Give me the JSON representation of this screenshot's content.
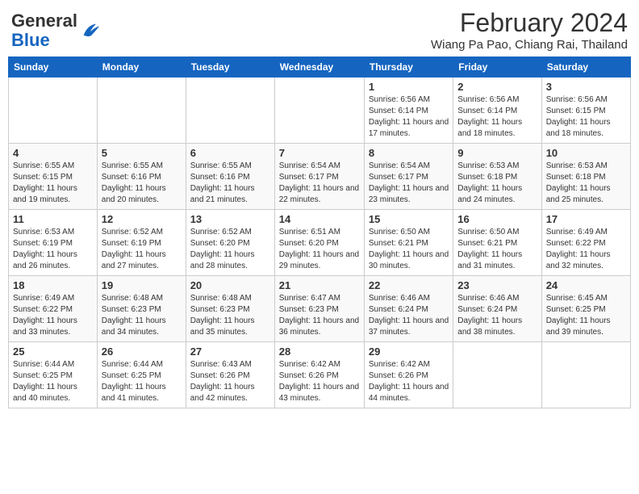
{
  "header": {
    "logo_general": "General",
    "logo_blue": "Blue",
    "month_year": "February 2024",
    "location": "Wiang Pa Pao, Chiang Rai, Thailand"
  },
  "days_of_week": [
    "Sunday",
    "Monday",
    "Tuesday",
    "Wednesday",
    "Thursday",
    "Friday",
    "Saturday"
  ],
  "weeks": [
    [
      {
        "day": "",
        "info": ""
      },
      {
        "day": "",
        "info": ""
      },
      {
        "day": "",
        "info": ""
      },
      {
        "day": "",
        "info": ""
      },
      {
        "day": "1",
        "info": "Sunrise: 6:56 AM\nSunset: 6:14 PM\nDaylight: 11 hours and 17 minutes."
      },
      {
        "day": "2",
        "info": "Sunrise: 6:56 AM\nSunset: 6:14 PM\nDaylight: 11 hours and 18 minutes."
      },
      {
        "day": "3",
        "info": "Sunrise: 6:56 AM\nSunset: 6:15 PM\nDaylight: 11 hours and 18 minutes."
      }
    ],
    [
      {
        "day": "4",
        "info": "Sunrise: 6:55 AM\nSunset: 6:15 PM\nDaylight: 11 hours and 19 minutes."
      },
      {
        "day": "5",
        "info": "Sunrise: 6:55 AM\nSunset: 6:16 PM\nDaylight: 11 hours and 20 minutes."
      },
      {
        "day": "6",
        "info": "Sunrise: 6:55 AM\nSunset: 6:16 PM\nDaylight: 11 hours and 21 minutes."
      },
      {
        "day": "7",
        "info": "Sunrise: 6:54 AM\nSunset: 6:17 PM\nDaylight: 11 hours and 22 minutes."
      },
      {
        "day": "8",
        "info": "Sunrise: 6:54 AM\nSunset: 6:17 PM\nDaylight: 11 hours and 23 minutes."
      },
      {
        "day": "9",
        "info": "Sunrise: 6:53 AM\nSunset: 6:18 PM\nDaylight: 11 hours and 24 minutes."
      },
      {
        "day": "10",
        "info": "Sunrise: 6:53 AM\nSunset: 6:18 PM\nDaylight: 11 hours and 25 minutes."
      }
    ],
    [
      {
        "day": "11",
        "info": "Sunrise: 6:53 AM\nSunset: 6:19 PM\nDaylight: 11 hours and 26 minutes."
      },
      {
        "day": "12",
        "info": "Sunrise: 6:52 AM\nSunset: 6:19 PM\nDaylight: 11 hours and 27 minutes."
      },
      {
        "day": "13",
        "info": "Sunrise: 6:52 AM\nSunset: 6:20 PM\nDaylight: 11 hours and 28 minutes."
      },
      {
        "day": "14",
        "info": "Sunrise: 6:51 AM\nSunset: 6:20 PM\nDaylight: 11 hours and 29 minutes."
      },
      {
        "day": "15",
        "info": "Sunrise: 6:50 AM\nSunset: 6:21 PM\nDaylight: 11 hours and 30 minutes."
      },
      {
        "day": "16",
        "info": "Sunrise: 6:50 AM\nSunset: 6:21 PM\nDaylight: 11 hours and 31 minutes."
      },
      {
        "day": "17",
        "info": "Sunrise: 6:49 AM\nSunset: 6:22 PM\nDaylight: 11 hours and 32 minutes."
      }
    ],
    [
      {
        "day": "18",
        "info": "Sunrise: 6:49 AM\nSunset: 6:22 PM\nDaylight: 11 hours and 33 minutes."
      },
      {
        "day": "19",
        "info": "Sunrise: 6:48 AM\nSunset: 6:23 PM\nDaylight: 11 hours and 34 minutes."
      },
      {
        "day": "20",
        "info": "Sunrise: 6:48 AM\nSunset: 6:23 PM\nDaylight: 11 hours and 35 minutes."
      },
      {
        "day": "21",
        "info": "Sunrise: 6:47 AM\nSunset: 6:23 PM\nDaylight: 11 hours and 36 minutes."
      },
      {
        "day": "22",
        "info": "Sunrise: 6:46 AM\nSunset: 6:24 PM\nDaylight: 11 hours and 37 minutes."
      },
      {
        "day": "23",
        "info": "Sunrise: 6:46 AM\nSunset: 6:24 PM\nDaylight: 11 hours and 38 minutes."
      },
      {
        "day": "24",
        "info": "Sunrise: 6:45 AM\nSunset: 6:25 PM\nDaylight: 11 hours and 39 minutes."
      }
    ],
    [
      {
        "day": "25",
        "info": "Sunrise: 6:44 AM\nSunset: 6:25 PM\nDaylight: 11 hours and 40 minutes."
      },
      {
        "day": "26",
        "info": "Sunrise: 6:44 AM\nSunset: 6:25 PM\nDaylight: 11 hours and 41 minutes."
      },
      {
        "day": "27",
        "info": "Sunrise: 6:43 AM\nSunset: 6:26 PM\nDaylight: 11 hours and 42 minutes."
      },
      {
        "day": "28",
        "info": "Sunrise: 6:42 AM\nSunset: 6:26 PM\nDaylight: 11 hours and 43 minutes."
      },
      {
        "day": "29",
        "info": "Sunrise: 6:42 AM\nSunset: 6:26 PM\nDaylight: 11 hours and 44 minutes."
      },
      {
        "day": "",
        "info": ""
      },
      {
        "day": "",
        "info": ""
      }
    ]
  ]
}
